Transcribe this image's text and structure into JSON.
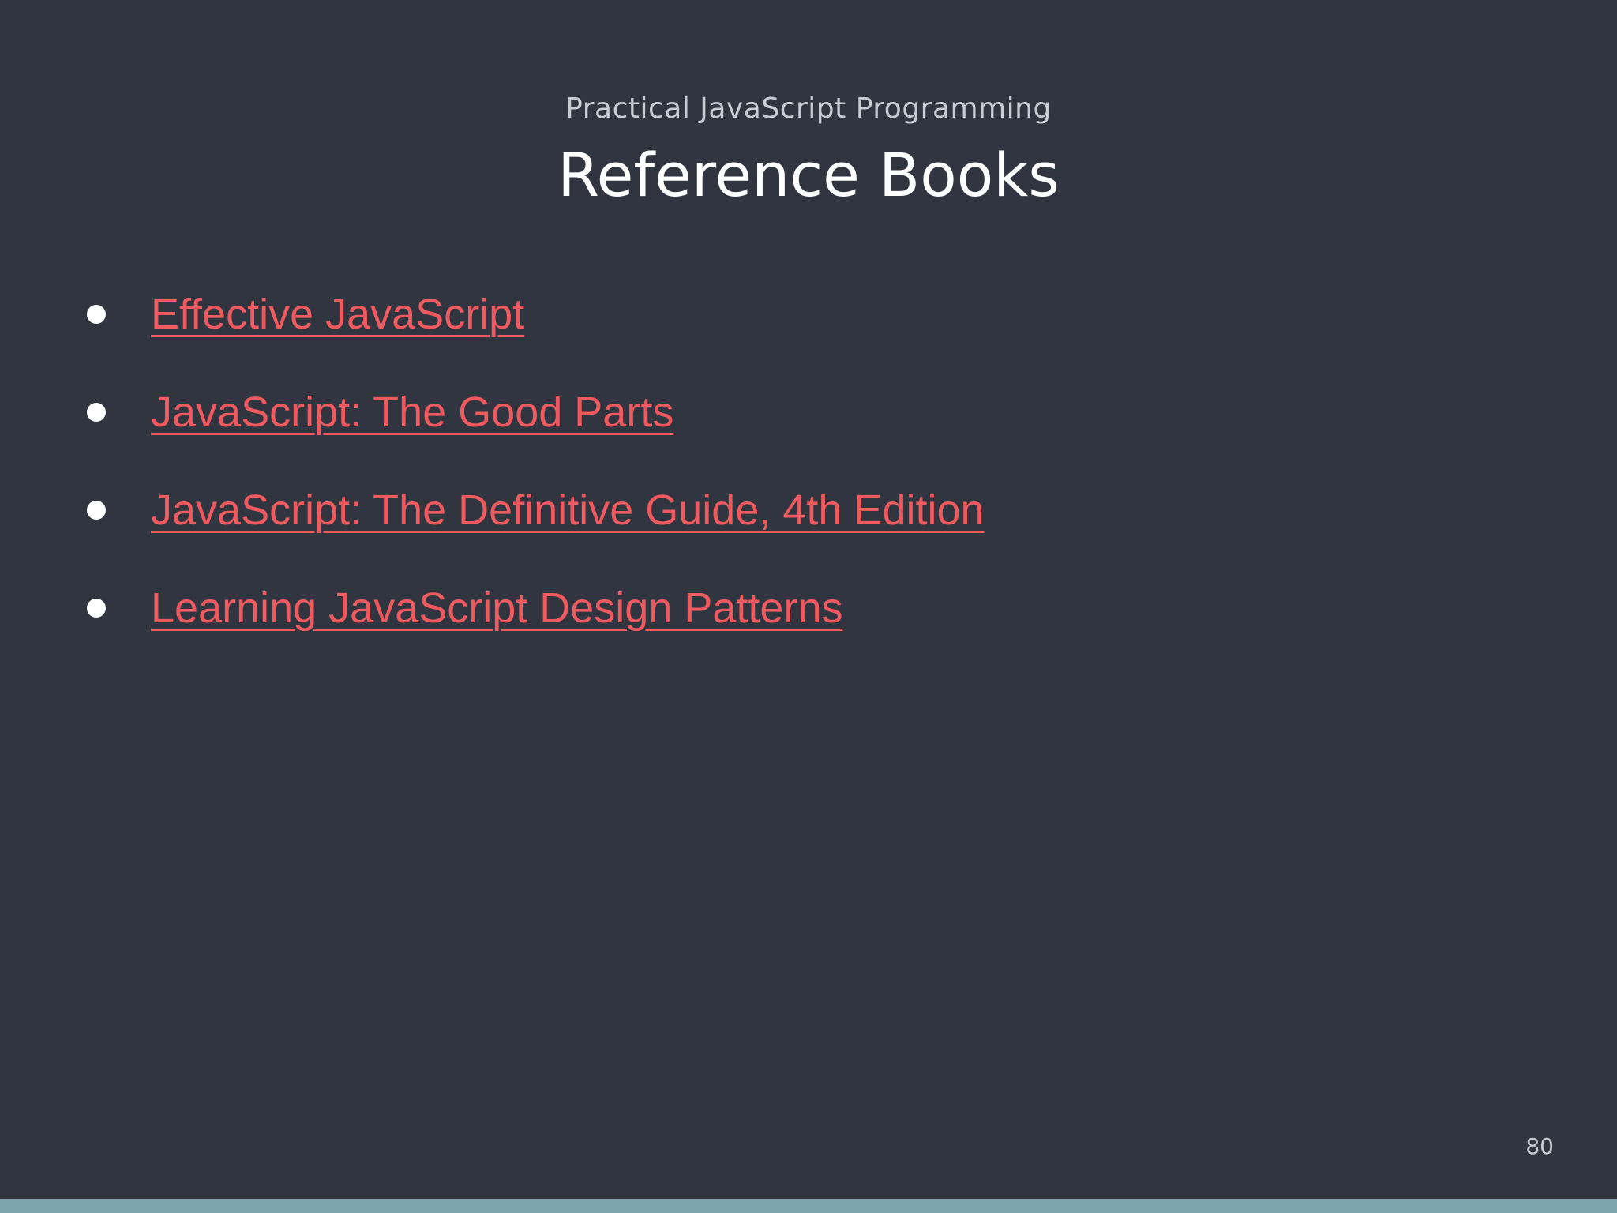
{
  "slide": {
    "deck_title": "Practical JavaScript Programming",
    "title": "Reference Books",
    "page_number": "80",
    "accent_color": "#ee5a5f",
    "footer_bar_color": "#7ba4ad",
    "background_color": "#31353f"
  },
  "books": [
    {
      "label": "Effective JavaScript"
    },
    {
      "label": "JavaScript: The Good Parts"
    },
    {
      "label": "JavaScript: The Definitive Guide, 4th Edition"
    },
    {
      "label": "Learning JavaScript Design Patterns"
    }
  ]
}
